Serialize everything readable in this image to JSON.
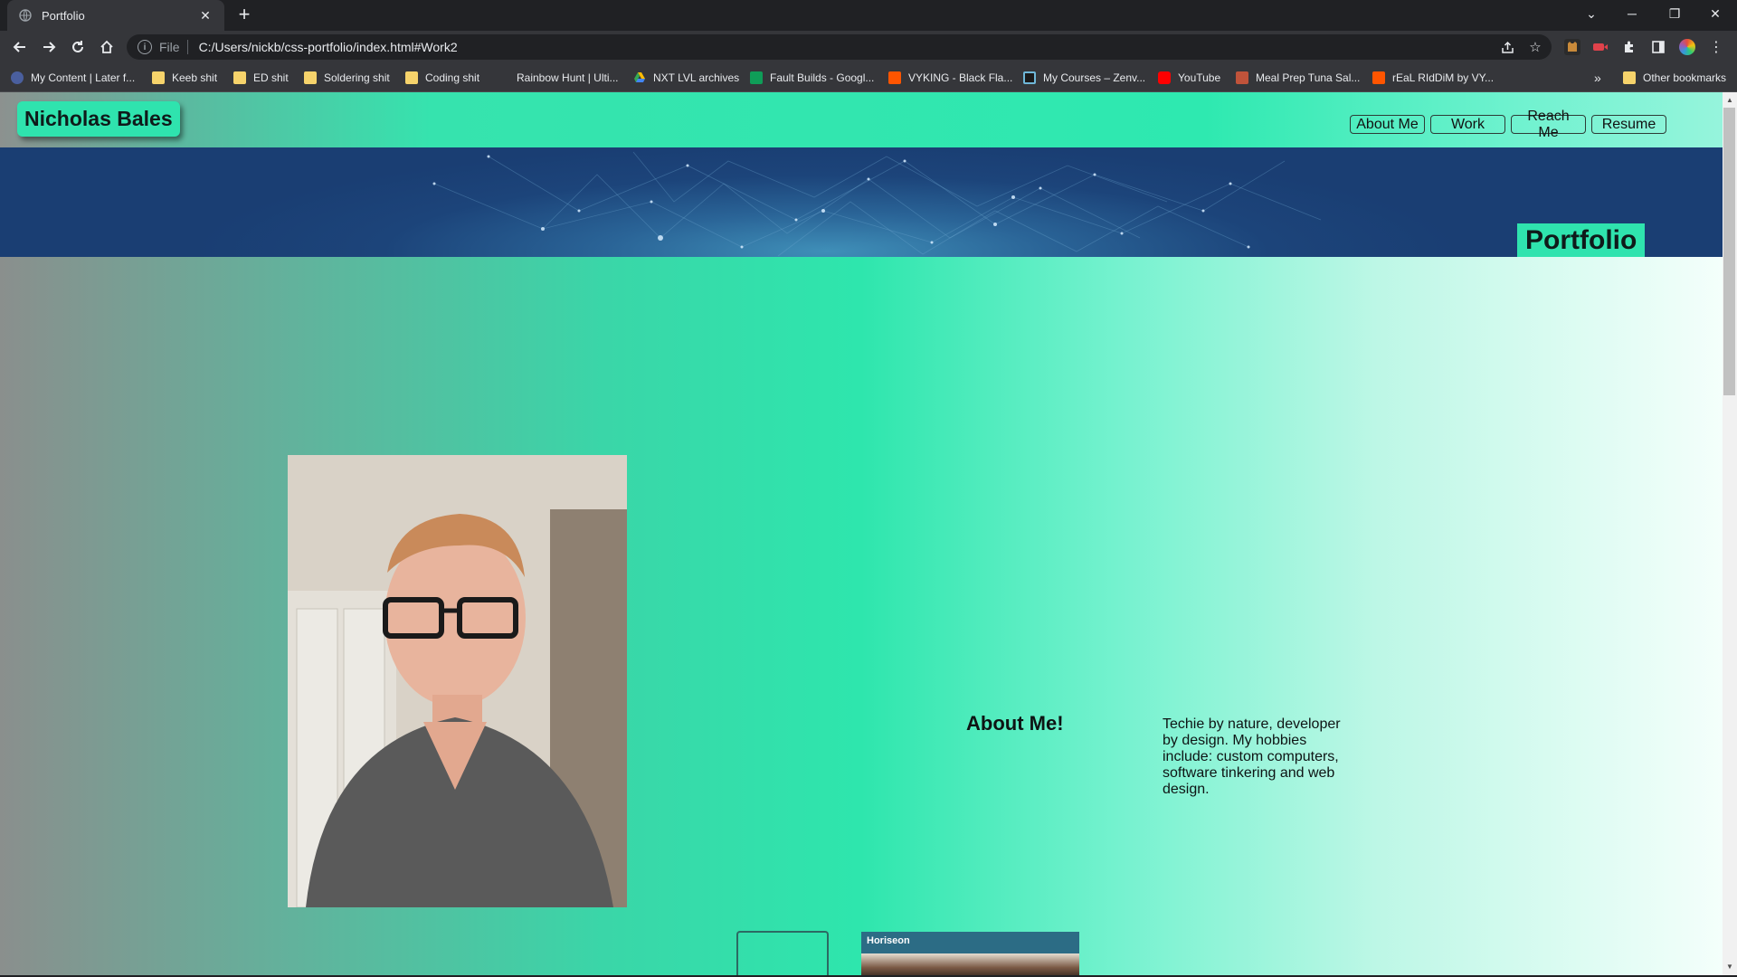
{
  "browser": {
    "tab_title": "Portfolio",
    "tab_close": "✕",
    "new_tab": "+",
    "url_scheme": "File",
    "url": "C:/Users/nickb/css-portfolio/index.html#Work2",
    "window_controls": {
      "tab_search": "⌄",
      "minimize": "─",
      "restore": "❐",
      "close": "✕"
    },
    "bookmarks": [
      {
        "label": "My Content | Later f...",
        "icon": "later-icon"
      },
      {
        "label": "Keeb shit",
        "icon": "folder-icon"
      },
      {
        "label": "ED shit",
        "icon": "folder-icon"
      },
      {
        "label": "Soldering shit",
        "icon": "folder-icon"
      },
      {
        "label": "Coding shit",
        "icon": "folder-icon"
      },
      {
        "label": "Rainbow Hunt | Ulti...",
        "icon": "none"
      },
      {
        "label": "NXT LVL archives",
        "icon": "drive-icon"
      },
      {
        "label": "Fault Builds - Googl...",
        "icon": "sheets-icon"
      },
      {
        "label": "VYKING - Black Fla...",
        "icon": "soundcloud-icon"
      },
      {
        "label": "My Courses – Zenv...",
        "icon": "zenva-icon"
      },
      {
        "label": "YouTube",
        "icon": "youtube-icon"
      },
      {
        "label": "Meal Prep Tuna Sal...",
        "icon": "recipe-icon"
      },
      {
        "label": "rEaL RIdDiM by VY...",
        "icon": "soundcloud-icon"
      }
    ],
    "bookmarks_overflow": "»",
    "other_bookmarks": "Other bookmarks"
  },
  "site": {
    "logo": "Nicholas Bales",
    "nav": [
      "About Me",
      "Work",
      "Reach Me",
      "Resume"
    ],
    "hero_title": "Portfolio",
    "about": {
      "heading": "About Me!",
      "text": "Techie by nature, developer by design. My hobbies include: custom computers, software tinkering and web design."
    },
    "work_card_label": "Horiseon"
  },
  "colors": {
    "accent": "#2fe3ae",
    "hero_blue": "#1c447a",
    "chrome_dark": "#202124",
    "chrome_toolbar": "#35363a"
  }
}
